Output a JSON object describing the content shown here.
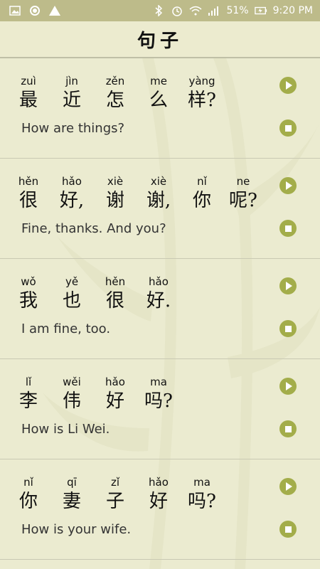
{
  "status": {
    "battery": "51%",
    "time": "9:20 PM"
  },
  "header": {
    "title": "句子"
  },
  "sentences": [
    {
      "words": [
        {
          "pinyin": "zuì",
          "hanzi": "最"
        },
        {
          "pinyin": "jìn",
          "hanzi": "近"
        },
        {
          "pinyin": "zěn",
          "hanzi": "怎"
        },
        {
          "pinyin": "me",
          "hanzi": "么"
        },
        {
          "pinyin": "yàng",
          "hanzi": "样?"
        }
      ],
      "english": "How are things?"
    },
    {
      "words": [
        {
          "pinyin": "hěn",
          "hanzi": "很"
        },
        {
          "pinyin": "hǎo",
          "hanzi": "好,"
        },
        {
          "pinyin": "xiè",
          "hanzi": "谢"
        },
        {
          "pinyin": "xiè",
          "hanzi": "谢,"
        },
        {
          "pinyin": "nǐ",
          "hanzi": "你"
        },
        {
          "pinyin": "ne",
          "hanzi": "呢?"
        }
      ],
      "english": "Fine, thanks. And you?"
    },
    {
      "words": [
        {
          "pinyin": "wǒ",
          "hanzi": "我"
        },
        {
          "pinyin": "yě",
          "hanzi": "也"
        },
        {
          "pinyin": "hěn",
          "hanzi": "很"
        },
        {
          "pinyin": "hǎo",
          "hanzi": "好."
        }
      ],
      "english": "I am fine, too."
    },
    {
      "words": [
        {
          "pinyin": "lǐ",
          "hanzi": "李"
        },
        {
          "pinyin": "wěi",
          "hanzi": "伟"
        },
        {
          "pinyin": "hǎo",
          "hanzi": "好"
        },
        {
          "pinyin": "ma",
          "hanzi": "吗?"
        }
      ],
      "english": "How is Li Wei."
    },
    {
      "words": [
        {
          "pinyin": "nǐ",
          "hanzi": "你"
        },
        {
          "pinyin": "qī",
          "hanzi": "妻"
        },
        {
          "pinyin": "zǐ",
          "hanzi": "子"
        },
        {
          "pinyin": "hǎo",
          "hanzi": "好"
        },
        {
          "pinyin": "ma",
          "hanzi": "吗?"
        }
      ],
      "english": "How is your wife."
    }
  ],
  "icons": {
    "play": "play-icon",
    "stop": "stop-icon"
  },
  "colors": {
    "accent": "#a3ad4a",
    "statusbar": "#bdbb8a",
    "background": "#ebebd0"
  }
}
